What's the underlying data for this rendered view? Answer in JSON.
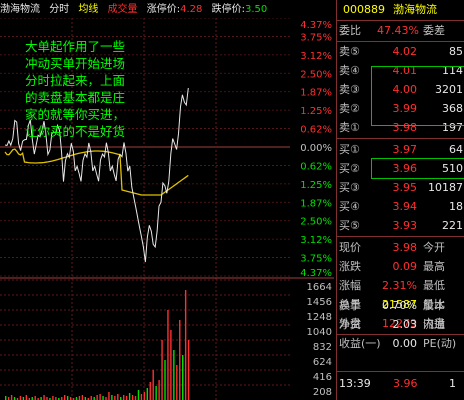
{
  "header": {
    "stock_name": "渤海物流",
    "tab_timeshare": "分时",
    "tab_avg": "均线",
    "tab_volume": "成交量",
    "limit_up_label": "涨停价:",
    "limit_up_value": "4.28",
    "limit_down_label": "跌停价:",
    "limit_down_value": "3.50"
  },
  "chart": {
    "pct_axis": [
      "4.37%",
      "3.75%",
      "3.12%",
      "2.50%",
      "1.87%",
      "1.25%",
      "0.62%",
      "0.00%",
      "0.62%",
      "1.25%",
      "1.87%",
      "2.50%",
      "3.12%",
      "3.75%",
      "4.37%"
    ],
    "vol_axis": [
      "1664",
      "1456",
      "1248",
      "1040",
      "832",
      "624",
      "416",
      "208"
    ],
    "annotation": [
      "大单起作用了一些",
      "冲动买单开始进场",
      "分时拉起来，上面",
      "的卖盘基本都是庄",
      "家的就等你买进，",
      "让你买的不是好货"
    ]
  },
  "panel": {
    "code": "000889",
    "name": "渤海物流",
    "ratio_label": "委比",
    "ratio_value": "47.43%",
    "diff_label": "委差",
    "diff_value": "",
    "sells": [
      {
        "label": "卖⑤",
        "price": "4.02",
        "vol": "85"
      },
      {
        "label": "卖④",
        "price": "4.01",
        "vol": "114"
      },
      {
        "label": "卖③",
        "price": "4.00",
        "vol": "3201"
      },
      {
        "label": "卖②",
        "price": "3.99",
        "vol": "368"
      },
      {
        "label": "卖①",
        "price": "3.98",
        "vol": "197"
      }
    ],
    "buys": [
      {
        "label": "买①",
        "price": "3.97",
        "vol": "64"
      },
      {
        "label": "买②",
        "price": "3.96",
        "vol": "510"
      },
      {
        "label": "买③",
        "price": "3.95",
        "vol": "10187"
      },
      {
        "label": "买④",
        "price": "3.94",
        "vol": "18"
      },
      {
        "label": "买⑤",
        "price": "3.93",
        "vol": "221"
      }
    ],
    "stats": [
      {
        "l1": "现价",
        "v1": "3.98",
        "c1": "red",
        "l2": "今开"
      },
      {
        "l1": "涨跌",
        "v1": "0.09",
        "c1": "red",
        "l2": "最高"
      },
      {
        "l1": "涨幅",
        "v1": "2.31%",
        "c1": "red",
        "l2": "最低"
      },
      {
        "l1": "总量",
        "v1": "21587",
        "c1": "yellow",
        "l2": "量比"
      },
      {
        "l1": "外盘",
        "v1": "12279",
        "c1": "red",
        "l2": "内盘"
      }
    ],
    "stats2": [
      {
        "l1": "换手",
        "v1": "0.70%",
        "l2": "股本"
      },
      {
        "l1": "净资",
        "v1": "2.03",
        "l2": "流通"
      },
      {
        "l1": "收益(一)",
        "v1": "0.00",
        "l2": "PE(动)"
      }
    ],
    "tick_time": "13:39",
    "tick_price": "3.96",
    "tick_vol": "1"
  },
  "colors": {
    "up": "#ff3030",
    "down": "#00e000",
    "avg": "#e0c000",
    "grid": "#803030"
  }
}
